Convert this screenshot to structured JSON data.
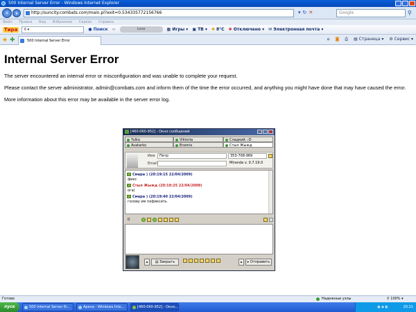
{
  "window": {
    "title": "500 Internal Server Error - Windows Internet Explorer"
  },
  "address_bar": {
    "url": "http://suncity.combats.com/main.pl?exit=0.534335772156766",
    "search_placeholder": "Google"
  },
  "menu": {
    "items": [
      "Файл",
      "Правка",
      "Вид",
      "Избранное",
      "Сервис",
      "Справка"
    ]
  },
  "toolbar": {
    "logo": "Тира",
    "search_label": "Поиск",
    "player_label": "Love",
    "items": [
      "Игры",
      "ТВ",
      "8°C",
      "Отключено",
      "Электронная почта"
    ]
  },
  "tabs": {
    "active_tab": "500 Internal Server Error",
    "page_menu": "Страница",
    "tools_menu": "Сервис"
  },
  "page": {
    "title": "Internal Server Error",
    "p1": "The server encountered an internal error or misconfiguration and was unable to complete your request.",
    "p2": "Please contact the server administrator, admin@combats.com and inform them of the time the error occurred, and anything you might have done that may have caused the error.",
    "p3": "More information about this error may be available in the server error log."
  },
  "miranda": {
    "title": "[460-060-952] - Окно сообщений",
    "tabs_row1": [
      "Yulka",
      "Viktoria",
      "Сладкий :-D"
    ],
    "tabs_row2": [
      "Avatarko",
      "Enemis",
      "Стыл Жыжд"
    ],
    "contact": {
      "name_label": "Имя",
      "name_value": "Петр",
      "email_label": "Email",
      "uin": "353-708-969",
      "client": "Miranda v. 0.7.19.0"
    },
    "messages": [
      {
        "header": "Смара ) (20:19:15 22/04/2009)",
        "text": "фикс",
        "color": "blue"
      },
      {
        "header": "Стыл Жыжд (20:19:25 22/04/2009)",
        "text": "ога(",
        "color": "red"
      },
      {
        "header": "Смара ) (20:19:40 22/04/2009)",
        "text": "голову им пофиксить",
        "color": "blue"
      }
    ],
    "char_count": "0",
    "close_button": "Закрыть",
    "send_button": "Отправить"
  },
  "statusbar": {
    "status": "Готово",
    "zone": "Надежные узлы",
    "zoom": "100%"
  },
  "taskbar": {
    "start": "пуск",
    "tasks": [
      "500 Internal Server Er...",
      "Арена - Windows Inte...",
      "[460-060-952] - Окно..."
    ],
    "clock": "20:21"
  }
}
